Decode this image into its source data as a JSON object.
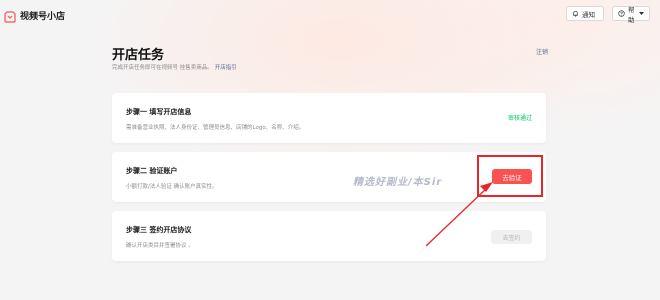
{
  "app": {
    "title": "视频号小店"
  },
  "header": {
    "notify_label": "通知",
    "help_label": "帮助"
  },
  "page": {
    "title": "开店任务",
    "subtitle": "完成开店任务即可在视频号 挂售卖商品。",
    "guide_link": "开店指引",
    "logout_label": "注销"
  },
  "steps": [
    {
      "title": "步骤一   填写开店信息",
      "desc": "需准备营业执照、法人身份证、管理员信息、店铺的Logo、名称、介绍。",
      "status": "审核通过"
    },
    {
      "title": "步骤二   验证账户",
      "desc": "小额打款/法人验证 确认账户真实性。",
      "button": "去验证"
    },
    {
      "title": "步骤三   签约开店协议",
      "desc": "确认开店类目并签署协议 。",
      "button": "去签约"
    }
  ],
  "overlay": {
    "watermark": "精选好副业/本Sir"
  },
  "colors": {
    "accent": "#fa5151",
    "success": "#07c160",
    "link": "#576b95",
    "annotation": "#e8262a"
  }
}
